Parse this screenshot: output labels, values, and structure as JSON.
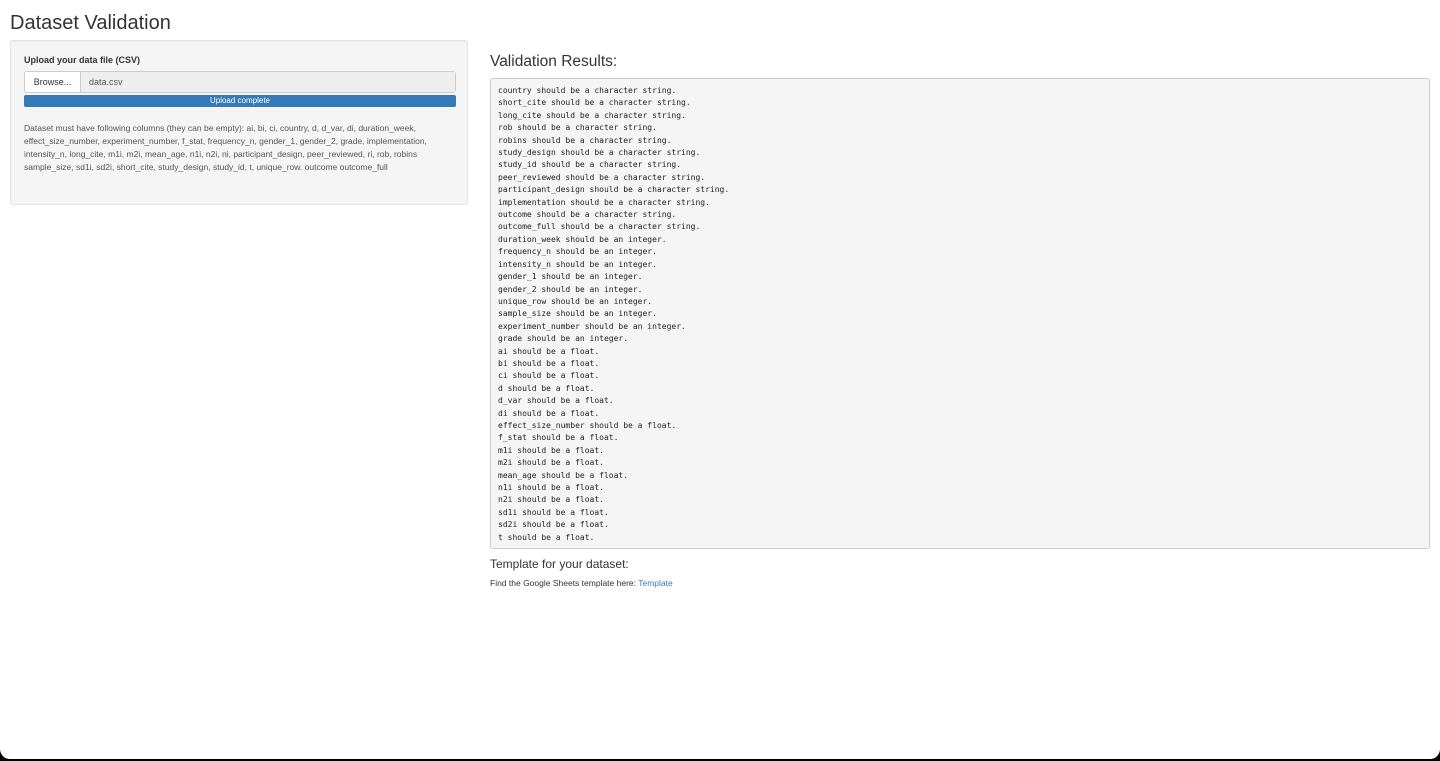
{
  "page": {
    "title": "Dataset Validation"
  },
  "upload": {
    "label": "Upload your data file (CSV)",
    "browse_label": "Browse...",
    "file_name": "data.csv",
    "progress_label": "Upload complete",
    "progress": 1.0,
    "help_text": "Dataset must have following columns (they can be empty): ai, bi, ci, country, d, d_var, di, duration_week, effect_size_number, experiment_number, f_stat, frequency_n, gender_1, gender_2, grade, implementation, intensity_n, long_cite, m1i, m2i, mean_age, n1i, n2i, ni, participant_design, peer_reviewed, ri, rob, robins sample_size, sd1i, sd2i, short_cite, study_design, study_id, t, unique_row. outcome outcome_full"
  },
  "results": {
    "heading": "Validation Results:",
    "lines": [
      "country should be a character string.",
      "short_cite should be a character string.",
      "long_cite should be a character string.",
      "rob should be a character string.",
      "robins should be a character string.",
      "study_design should be a character string.",
      "study_id should be a character string.",
      "peer_reviewed should be a character string.",
      "participant_design should be a character string.",
      "implementation should be a character string.",
      "outcome should be a character string.",
      "outcome_full should be a character string.",
      "duration_week should be an integer.",
      "frequency_n should be an integer.",
      "intensity_n should be an integer.",
      "gender_1 should be an integer.",
      "gender_2 should be an integer.",
      "unique_row should be an integer.",
      "sample_size should be an integer.",
      "experiment_number should be an integer.",
      "grade should be an integer.",
      "ai should be a float.",
      "bi should be a float.",
      "ci should be a float.",
      "d should be a float.",
      "d_var should be a float.",
      "di should be a float.",
      "effect_size_number should be a float.",
      "f_stat should be a float.",
      "m1i should be a float.",
      "m2i should be a float.",
      "mean_age should be a float.",
      "n1i should be a float.",
      "n2i should be a float.",
      "sd1i should be a float.",
      "sd2i should be a float.",
      "t should be a float."
    ]
  },
  "template": {
    "heading": "Template for your dataset:",
    "text": "Find the Google Sheets template here: ",
    "link_label": "Template"
  },
  "colors": {
    "accent": "#337ab7",
    "panel_bg": "#f5f5f5"
  }
}
